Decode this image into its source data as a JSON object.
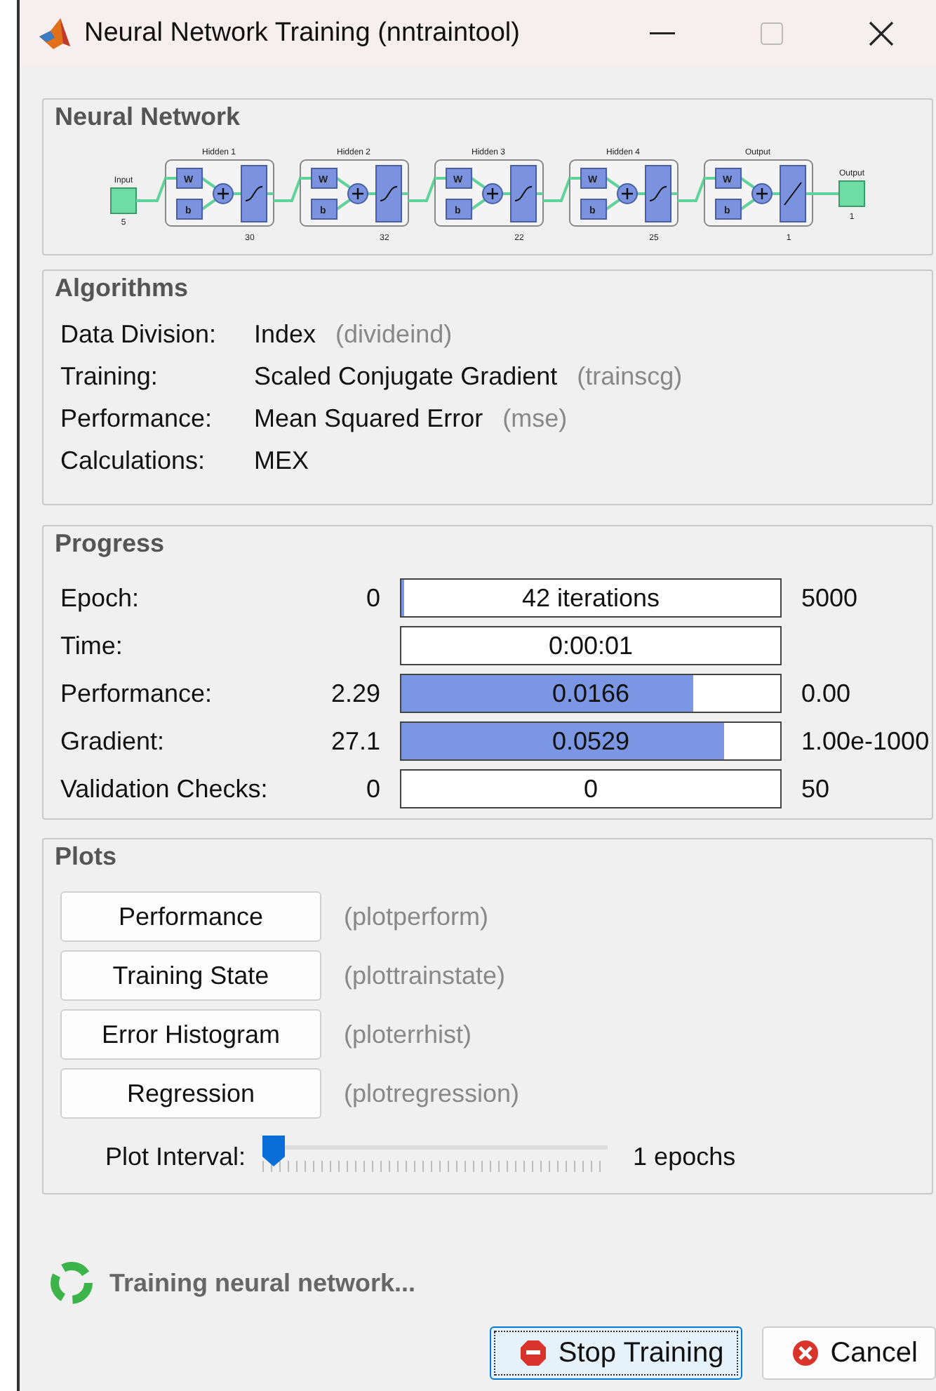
{
  "window": {
    "title": "Neural Network Training (nntraintool)"
  },
  "network": {
    "title": "Neural Network",
    "input": {
      "label": "Input",
      "size": "5"
    },
    "layers": [
      {
        "label": "Hidden 1",
        "size": "30",
        "kind": "sigmoid",
        "weight": "W",
        "bias": "b"
      },
      {
        "label": "Hidden 2",
        "size": "32",
        "kind": "sigmoid",
        "weight": "W",
        "bias": "b"
      },
      {
        "label": "Hidden 3",
        "size": "22",
        "kind": "sigmoid",
        "weight": "W",
        "bias": "b"
      },
      {
        "label": "Hidden 4",
        "size": "25",
        "kind": "sigmoid",
        "weight": "W",
        "bias": "b"
      },
      {
        "label": "Output",
        "size": "1",
        "kind": "linear",
        "weight": "W",
        "bias": "b"
      }
    ],
    "output": {
      "label": "Output",
      "size": "1"
    }
  },
  "algorithms": {
    "title": "Algorithms",
    "rows": [
      {
        "label": "Data Division:",
        "value": "Index",
        "function": "(divideind)"
      },
      {
        "label": "Training:",
        "value": "Scaled Conjugate Gradient",
        "function": "(trainscg)"
      },
      {
        "label": "Performance:",
        "value": "Mean Squared Error",
        "function": "(mse)"
      },
      {
        "label": "Calculations:",
        "value": "MEX"
      }
    ]
  },
  "progress": {
    "title": "Progress",
    "rows": [
      {
        "label": "Epoch:",
        "start": "0",
        "value": "42 iterations",
        "level": 0.008,
        "end": "5000"
      },
      {
        "label": "Time:",
        "value": "0:00:01",
        "level": 0
      },
      {
        "label": "Performance:",
        "start": "2.29",
        "value": "0.0166",
        "level": 0.77,
        "end": "0.00"
      },
      {
        "label": "Gradient:",
        "start": "27.1",
        "value": "0.0529",
        "level": 0.85,
        "end": "1.00e-1000"
      },
      {
        "label": "Validation Checks:",
        "start": "0",
        "value": "0",
        "level": 0,
        "end": "50"
      }
    ]
  },
  "plots": {
    "title": "Plots",
    "buttons": [
      {
        "label": "Performance",
        "function": "(plotperform)"
      },
      {
        "label": "Training State",
        "function": "(plottrainstate)"
      },
      {
        "label": "Error Histogram",
        "function": "(ploterrhist)"
      },
      {
        "label": "Regression",
        "function": "(plotregression)"
      }
    ],
    "interval": {
      "label": "Plot Interval:",
      "level": 0,
      "reading": "1 epochs"
    }
  },
  "status": {
    "text": "Training neural network..."
  },
  "buttons": [
    {
      "label": "Stop Training",
      "kind": "stop",
      "focused": true
    },
    {
      "label": "Cancel",
      "kind": "cancel",
      "focused": false
    }
  ]
}
